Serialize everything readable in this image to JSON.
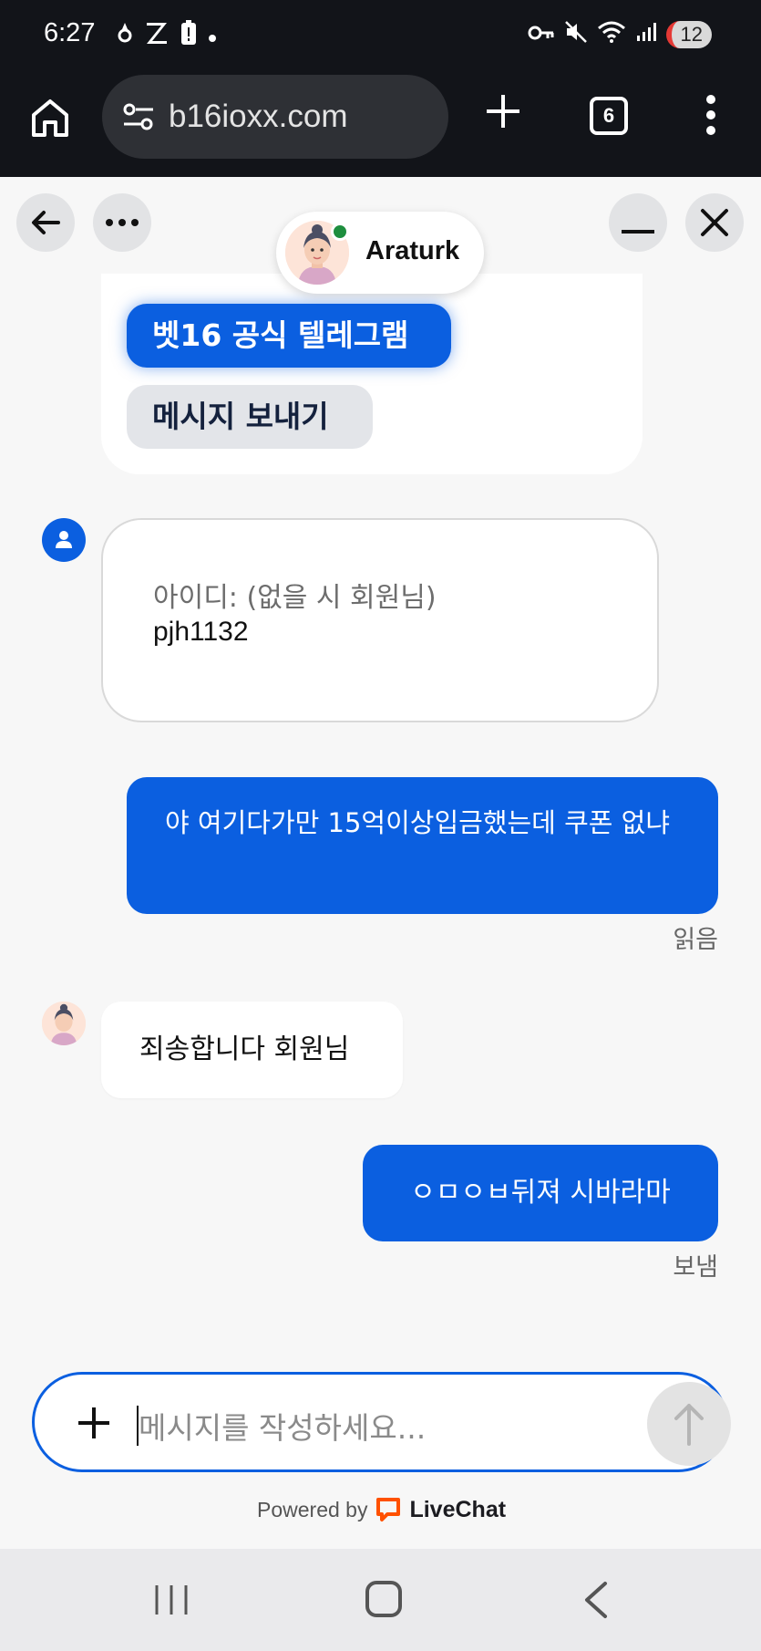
{
  "status_bar": {
    "time": "6:27",
    "battery_level": "12",
    "icons": [
      "flame-icon",
      "z-app-icon",
      "battery-alert-icon",
      "dot-icon",
      "vpn-key-icon",
      "mute-icon",
      "wifi-icon",
      "signal-icon"
    ]
  },
  "browser": {
    "url": "b16ioxx.com",
    "tab_count": "6"
  },
  "chat_header": {
    "agent_name": "Araturk",
    "agent_status": "online"
  },
  "top_card": {
    "telegram_button": "벳16 공식 텔레그램",
    "send_message_button": "메시지 보내기"
  },
  "form_card": {
    "label": "아이디: (없을 시 회원님)",
    "value": "pjh1132"
  },
  "messages": [
    {
      "from": "visitor",
      "text": "야 여기다가만 15억이상입금했는데 쿠폰 없냐",
      "receipt": "읽음"
    },
    {
      "from": "agent",
      "text": "죄송합니다 회원님"
    },
    {
      "from": "visitor",
      "text": "ㅇㅁㅇㅂ뒤져 시바라마",
      "receipt": "보냄"
    }
  ],
  "composer": {
    "placeholder": "메시지를 작성하세요..."
  },
  "footer": {
    "powered_by": "Powered by",
    "brand": "LiveChat"
  },
  "colors": {
    "accent": "#0b5fe0",
    "online": "#1e8e3e",
    "livechat_orange": "#ff5100"
  }
}
